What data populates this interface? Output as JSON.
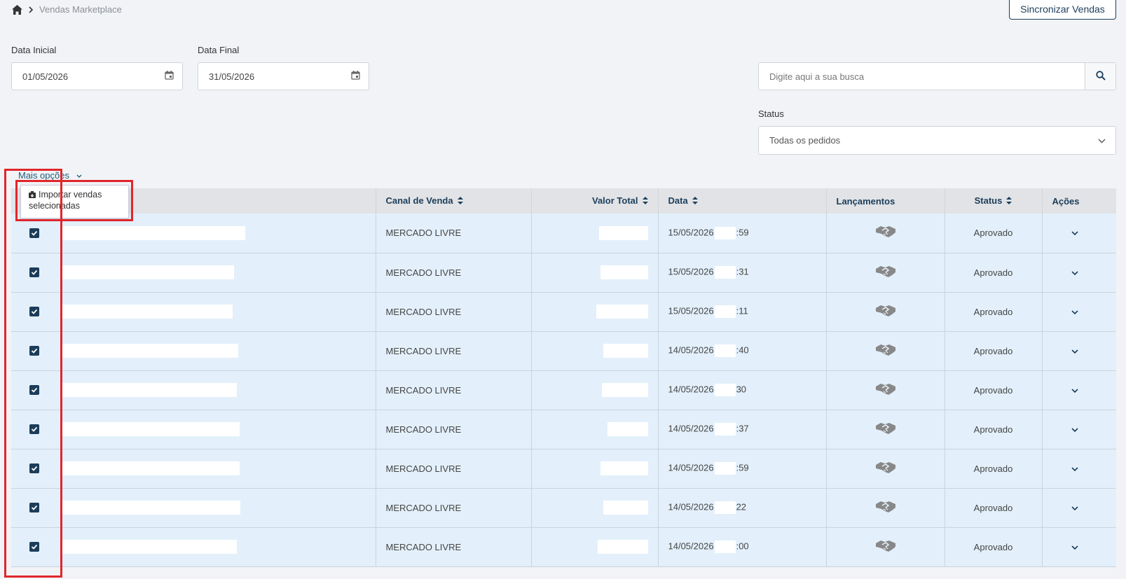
{
  "breadcrumb": {
    "home_icon": "home-icon",
    "separator_icon": "chevron-right-icon",
    "current": "Vendas Marketplace"
  },
  "sync_button": "Sincronizar Vendas",
  "filters": {
    "start_date_label": "Data Inicial",
    "start_date_value": "01/05/2026",
    "end_date_label": "Data Final",
    "end_date_value": "31/05/2026",
    "search_placeholder": "Digite aqui a sua busca",
    "status_label": "Status",
    "status_value": "Todas os pedidos"
  },
  "more_options": {
    "label": "Mais opções",
    "menu_item": "Importar vendas selecionadas"
  },
  "table": {
    "headers": [
      "",
      "Canal de Venda",
      "Valor Total",
      "Data",
      "Lançamentos",
      "Status",
      "Ações"
    ],
    "rows": [
      {
        "checked": true,
        "channel": "MERCADO LIVRE",
        "date_prefix": "15/05/2026",
        "date_suffix": ":59",
        "status": "Aprovado"
      },
      {
        "checked": true,
        "channel": "MERCADO LIVRE",
        "date_prefix": "15/05/2026",
        "date_suffix": ":31",
        "status": "Aprovado"
      },
      {
        "checked": true,
        "channel": "MERCADO LIVRE",
        "date_prefix": "15/05/2026",
        "date_suffix": ":11",
        "status": "Aprovado"
      },
      {
        "checked": true,
        "channel": "MERCADO LIVRE",
        "date_prefix": "14/05/2026",
        "date_suffix": ":40",
        "status": "Aprovado"
      },
      {
        "checked": true,
        "channel": "MERCADO LIVRE",
        "date_prefix": "14/05/2026",
        "date_suffix": "30",
        "status": "Aprovado"
      },
      {
        "checked": true,
        "channel": "MERCADO LIVRE",
        "date_prefix": "14/05/2026",
        "date_suffix": ":37",
        "status": "Aprovado"
      },
      {
        "checked": true,
        "channel": "MERCADO LIVRE",
        "date_prefix": "14/05/2026",
        "date_suffix": ":59",
        "status": "Aprovado"
      },
      {
        "checked": true,
        "channel": "MERCADO LIVRE",
        "date_prefix": "14/05/2026",
        "date_suffix": "22",
        "status": "Aprovado"
      },
      {
        "checked": true,
        "channel": "MERCADO LIVRE",
        "date_prefix": "14/05/2026",
        "date_suffix": ":00",
        "status": "Aprovado"
      }
    ]
  },
  "colors": {
    "primary": "#1c3d5a",
    "highlight": "#e0262b",
    "row_bg": "#e3f0fb",
    "header_bg": "#e1e3e6"
  }
}
